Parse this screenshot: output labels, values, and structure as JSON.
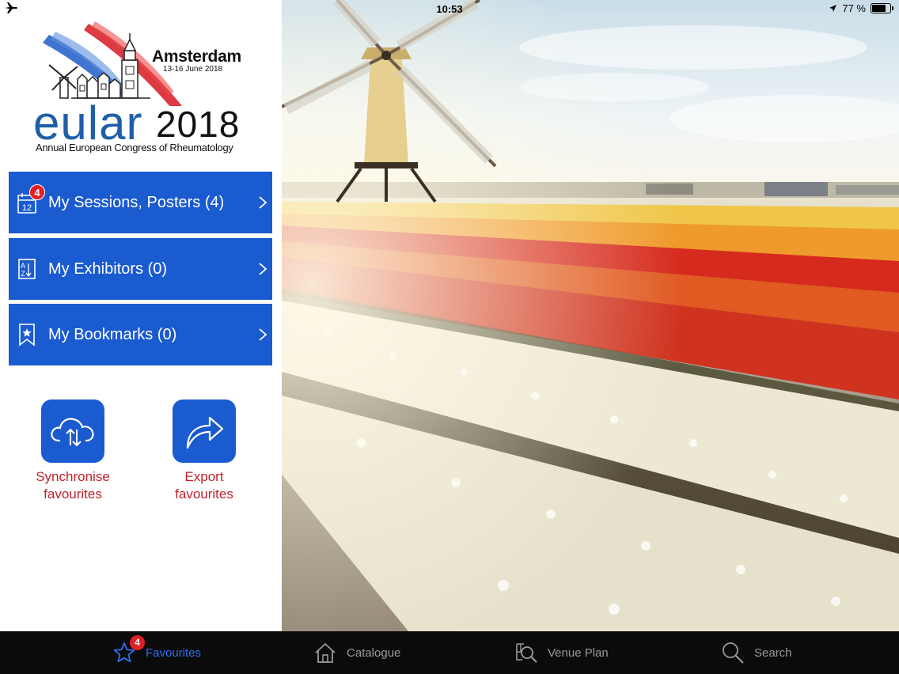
{
  "status_bar": {
    "time": "10:53",
    "battery": "77 %",
    "battery_level": 0.77
  },
  "logo": {
    "city": "Amsterdam",
    "dates": "13-16 June 2018",
    "brand": "eular",
    "year": "2018",
    "tagline": "Annual European Congress of Rheumatology"
  },
  "menu": {
    "items": [
      {
        "label": "My Sessions, Posters (4)",
        "icon": "calendar-icon",
        "badge": "4",
        "calendar_day": "12"
      },
      {
        "label": "My Exhibitors (0)",
        "icon": "az-list-icon"
      },
      {
        "label": "My Bookmarks (0)",
        "icon": "bookmark-star-icon"
      }
    ]
  },
  "actions": [
    {
      "label_line1": "Synchronise",
      "label_line2": "favourites",
      "icon": "cloud-sync-icon"
    },
    {
      "label_line1": "Export",
      "label_line2": "favourites",
      "icon": "share-arrow-icon"
    }
  ],
  "tabbar": {
    "tabs": [
      {
        "label": "Favourites",
        "icon": "star-icon",
        "badge": "4",
        "active": true
      },
      {
        "label": "Catalogue",
        "icon": "home-icon",
        "active": false
      },
      {
        "label": "Venue Plan",
        "icon": "map-search-icon",
        "active": false
      },
      {
        "label": "Search",
        "icon": "search-icon",
        "active": false
      }
    ]
  },
  "colors": {
    "primary_blue": "#1a5bd0",
    "caption_red": "#c0202a",
    "badge_red": "#e21f26",
    "tab_active": "#2d6ff0",
    "tab_inactive": "#9a9a9a",
    "tabbar_bg": "#0b0b0b"
  }
}
